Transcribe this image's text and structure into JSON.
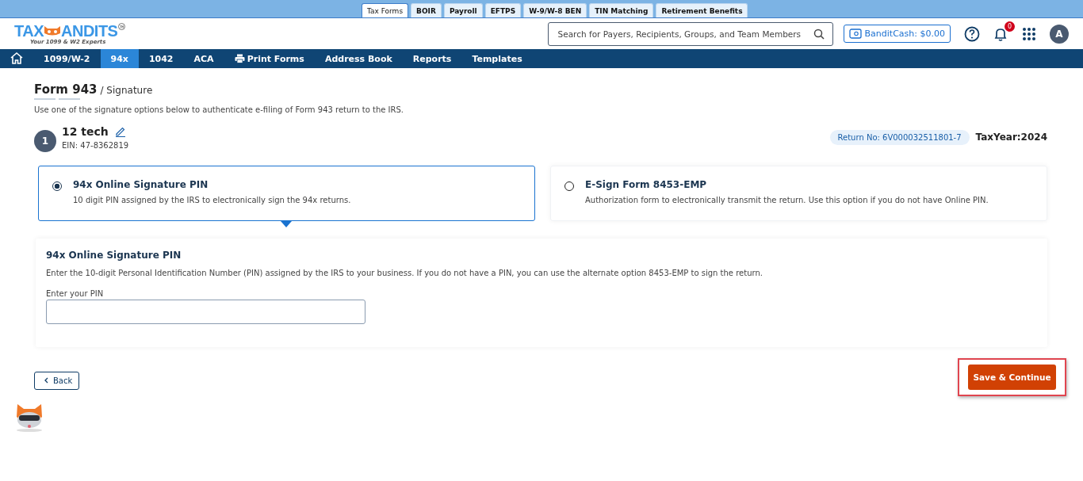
{
  "product_tabs": [
    {
      "label": "Tax Forms",
      "selected": true
    },
    {
      "label": "BOIR",
      "selected": false
    },
    {
      "label": "Payroll",
      "selected": false
    },
    {
      "label": "EFTPS",
      "selected": false
    },
    {
      "label": "W-9/W-8 BEN",
      "selected": false
    },
    {
      "label": "TIN Matching",
      "selected": false
    },
    {
      "label": "Retirement Benefits",
      "selected": false
    }
  ],
  "logo": {
    "left": "TAX",
    "right": "ANDITS",
    "tagline": "Your 1099 & W2 Experts"
  },
  "search": {
    "placeholder": "Search for Payers, Recipients, Groups, and Team Members"
  },
  "bandit_cash": "BanditCash: $0.00",
  "notifications": "0",
  "avatar": "A",
  "nav": [
    {
      "label": "1099/W-2",
      "selected": false,
      "kind": "text"
    },
    {
      "label": "94x",
      "selected": true,
      "kind": "text"
    },
    {
      "label": "1042",
      "selected": false,
      "kind": "text"
    },
    {
      "label": "ACA",
      "selected": false,
      "kind": "text"
    },
    {
      "label": "Print Forms",
      "selected": false,
      "kind": "print"
    },
    {
      "label": "Address Book",
      "selected": false,
      "kind": "text"
    },
    {
      "label": "Reports",
      "selected": false,
      "kind": "text"
    },
    {
      "label": "Templates",
      "selected": false,
      "kind": "text"
    }
  ],
  "page": {
    "title": "Form 943",
    "subtitle": "/ Signature",
    "intro": "Use one of the signature options below to authenticate e-filing of Form 943 return to the IRS."
  },
  "business": {
    "step": "1",
    "name": "12 tech",
    "ein": "EIN: 47-8362819",
    "return_no": "Return No: 6V000032511801-7",
    "tax_year": "TaxYear:2024"
  },
  "options": [
    {
      "title": "94x Online Signature PIN",
      "description": "10 digit PIN assigned by the IRS to electronically sign the 94x returns.",
      "selected": true
    },
    {
      "title": "E-Sign Form 8453-EMP",
      "description": "Authorization form to electronically transmit the return. Use this option if you do not have Online PIN.",
      "selected": false
    }
  ],
  "pin_panel": {
    "title": "94x Online Signature PIN",
    "description": "Enter the 10-digit Personal Identification Number (PIN) assigned by the IRS to your business. If you do not have a PIN, you can use the alternate option 8453-EMP to sign the return.",
    "label": "Enter your PIN"
  },
  "back": "Back",
  "save": {
    "label": "Save & Continue",
    "highlighted": true
  }
}
